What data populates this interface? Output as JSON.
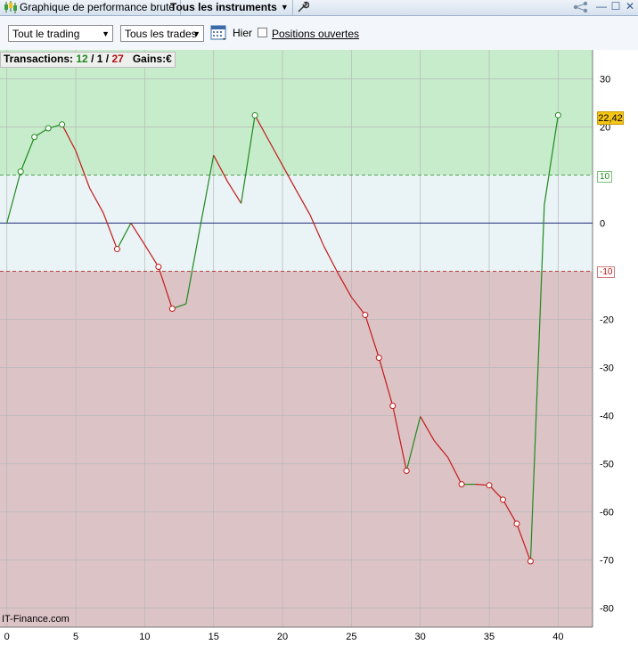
{
  "titlebar": {
    "tab_perf": "Graphique de performance brute",
    "tab_instruments": "Tous les instruments"
  },
  "toolbar": {
    "trading_select": "Tout le trading",
    "trades_select": "Tous les trades",
    "hier_label": "Hier",
    "positions_label": "Positions ouvertes",
    "positions_checked": false
  },
  "info": {
    "transactions_label": "Transactions:",
    "wins": "12",
    "sep1": " / ",
    "even": "1",
    "sep2": " / ",
    "losses": "27",
    "gains_label": "Gains:",
    "currency": "€"
  },
  "watermark": "IT-Finance.com",
  "colors": {
    "zone_upper": "#c7eccb",
    "zone_neutral": "#eaf3f6",
    "zone_lower": "#dcc3c6",
    "line_up": "#1f8a1f",
    "line_down": "#c41a1a",
    "zero_line": "#1f2a7a"
  },
  "chart_data": {
    "type": "line",
    "title": "",
    "xlabel": "",
    "ylabel": "",
    "xlim": [
      -0.5,
      42.5
    ],
    "ylim": [
      -84,
      36
    ],
    "x_ticks": [
      0,
      5,
      10,
      15,
      20,
      25,
      30,
      35,
      40
    ],
    "y_ticks": [
      30,
      20,
      0,
      -20,
      -30,
      -40,
      -50,
      -60,
      -70,
      -80
    ],
    "thresholds": {
      "upper": 10,
      "lower": -10,
      "upper_label": "10",
      "lower_label": "-10"
    },
    "grid": true,
    "last_value_label": "22,42",
    "points": [
      {
        "x": 0,
        "y": 0,
        "marker": false
      },
      {
        "x": 1,
        "y": 10.7,
        "marker": true
      },
      {
        "x": 2,
        "y": 17.9,
        "marker": true
      },
      {
        "x": 3,
        "y": 19.7,
        "marker": true
      },
      {
        "x": 4,
        "y": 20.5,
        "marker": true
      },
      {
        "x": 5,
        "y": 15,
        "marker": false
      },
      {
        "x": 6,
        "y": 7.3,
        "marker": false
      },
      {
        "x": 7,
        "y": 2.1,
        "marker": false
      },
      {
        "x": 8,
        "y": -5.4,
        "marker": true
      },
      {
        "x": 9,
        "y": 0,
        "marker": false
      },
      {
        "x": 10,
        "y": -4.5,
        "marker": false
      },
      {
        "x": 11,
        "y": -9.1,
        "marker": true
      },
      {
        "x": 12,
        "y": -17.8,
        "marker": true
      },
      {
        "x": 13,
        "y": -16.8,
        "marker": false
      },
      {
        "x": 14,
        "y": -1.2,
        "marker": false
      },
      {
        "x": 15,
        "y": 14.1,
        "marker": false
      },
      {
        "x": 16,
        "y": 8.7,
        "marker": false
      },
      {
        "x": 17,
        "y": 4.1,
        "marker": false
      },
      {
        "x": 18,
        "y": 22.4,
        "marker": true
      },
      {
        "x": 19,
        "y": 17.2,
        "marker": false
      },
      {
        "x": 20,
        "y": 12,
        "marker": false
      },
      {
        "x": 21,
        "y": 6.8,
        "marker": false
      },
      {
        "x": 22,
        "y": 1.7,
        "marker": false
      },
      {
        "x": 23,
        "y": -4.8,
        "marker": false
      },
      {
        "x": 24,
        "y": -10.3,
        "marker": false
      },
      {
        "x": 25,
        "y": -15.4,
        "marker": false
      },
      {
        "x": 26,
        "y": -19.1,
        "marker": true
      },
      {
        "x": 27,
        "y": -28,
        "marker": true
      },
      {
        "x": 28,
        "y": -38,
        "marker": true
      },
      {
        "x": 29,
        "y": -51.5,
        "marker": true
      },
      {
        "x": 30,
        "y": -40.2,
        "marker": false
      },
      {
        "x": 31,
        "y": -45.2,
        "marker": false
      },
      {
        "x": 32,
        "y": -48.7,
        "marker": false
      },
      {
        "x": 33,
        "y": -54.3,
        "marker": true
      },
      {
        "x": 34,
        "y": -54.3,
        "marker": false
      },
      {
        "x": 35,
        "y": -54.5,
        "marker": true
      },
      {
        "x": 36,
        "y": -57.5,
        "marker": true
      },
      {
        "x": 37,
        "y": -62.5,
        "marker": true
      },
      {
        "x": 38,
        "y": -70.3,
        "marker": true
      },
      {
        "x": 39,
        "y": 3.8,
        "marker": false
      },
      {
        "x": 40,
        "y": 22.42,
        "marker": true
      }
    ]
  }
}
